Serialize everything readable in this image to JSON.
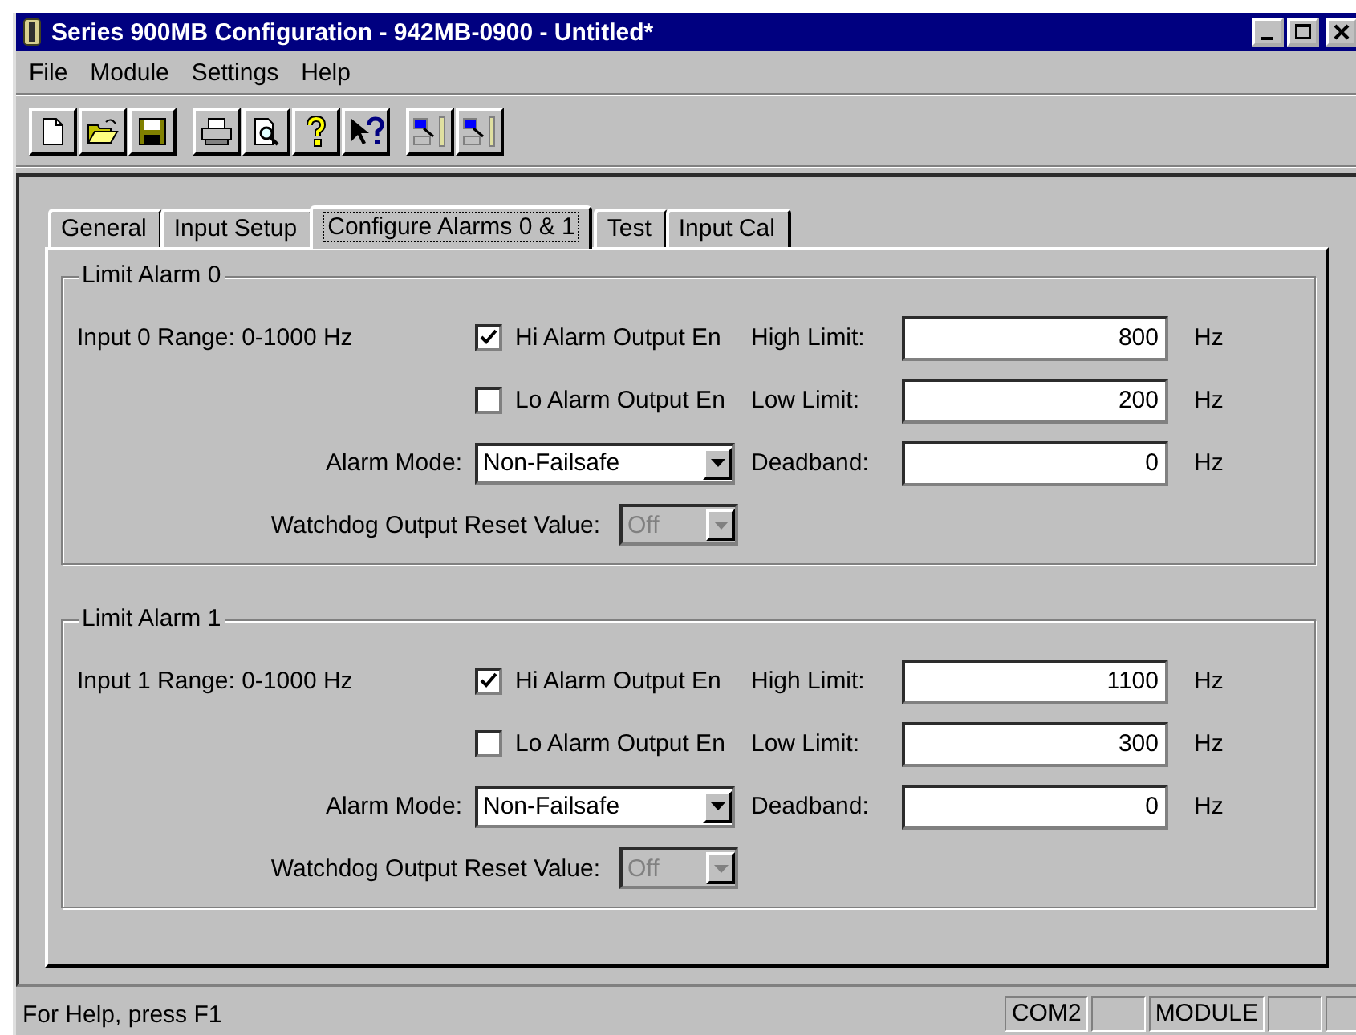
{
  "window": {
    "title": "Series 900MB Configuration - 942MB-0900 - Untitled*"
  },
  "menu": [
    {
      "label": "File"
    },
    {
      "label": "Module"
    },
    {
      "label": "Settings"
    },
    {
      "label": "Help"
    }
  ],
  "toolbar": [
    {
      "group": [
        {
          "kind": "new"
        },
        {
          "kind": "open"
        },
        {
          "kind": "save"
        }
      ]
    },
    {
      "group": [
        {
          "kind": "print"
        },
        {
          "kind": "preview"
        },
        {
          "kind": "help"
        },
        {
          "kind": "context-help"
        }
      ]
    },
    {
      "group": [
        {
          "kind": "download"
        },
        {
          "kind": "upload"
        }
      ]
    }
  ],
  "tabs": [
    {
      "label": "General",
      "selected": false
    },
    {
      "label": "Input Setup",
      "selected": false
    },
    {
      "label": "Configure Alarms 0 & 1",
      "selected": true
    },
    {
      "label": "Test",
      "selected": false
    },
    {
      "label": "Input Cal",
      "selected": false
    }
  ],
  "alarms": [
    {
      "title": "Limit Alarm 0",
      "range": "Input 0 Range: 0-1000 Hz",
      "hi": {
        "label": "Hi Alarm Output En",
        "checked": true
      },
      "lo": {
        "label": "Lo Alarm Output En",
        "checked": false
      },
      "high_limit": {
        "label": "High Limit:",
        "value": "800",
        "unit": "Hz"
      },
      "low_limit": {
        "label": "Low Limit:",
        "value": "200",
        "unit": "Hz"
      },
      "deadband": {
        "label": "Deadband:",
        "value": "0",
        "unit": "Hz"
      },
      "mode": {
        "label": "Alarm Mode:",
        "value": "Non-Failsafe"
      },
      "watchdog": {
        "label": "Watchdog Output Reset Value:",
        "value": "Off",
        "disabled": true
      }
    },
    {
      "title": "Limit Alarm 1",
      "range": "Input 1 Range: 0-1000 Hz",
      "hi": {
        "label": "Hi Alarm Output En",
        "checked": true
      },
      "lo": {
        "label": "Lo Alarm Output En",
        "checked": false
      },
      "high_limit": {
        "label": "High Limit:",
        "value": "1100",
        "unit": "Hz"
      },
      "low_limit": {
        "label": "Low Limit:",
        "value": "300",
        "unit": "Hz"
      },
      "deadband": {
        "label": "Deadband:",
        "value": "0",
        "unit": "Hz"
      },
      "mode": {
        "label": "Alarm Mode:",
        "value": "Non-Failsafe"
      },
      "watchdog": {
        "label": "Watchdog Output Reset Value:",
        "value": "Off",
        "disabled": true
      }
    }
  ],
  "status_bar": {
    "text": "For Help, press F1",
    "panes": [
      {
        "kind": "text",
        "text": "COM2"
      },
      {
        "kind": "empty"
      },
      {
        "kind": "text",
        "text": "MODULE"
      },
      {
        "kind": "empty"
      },
      {
        "kind": "empty"
      }
    ]
  }
}
